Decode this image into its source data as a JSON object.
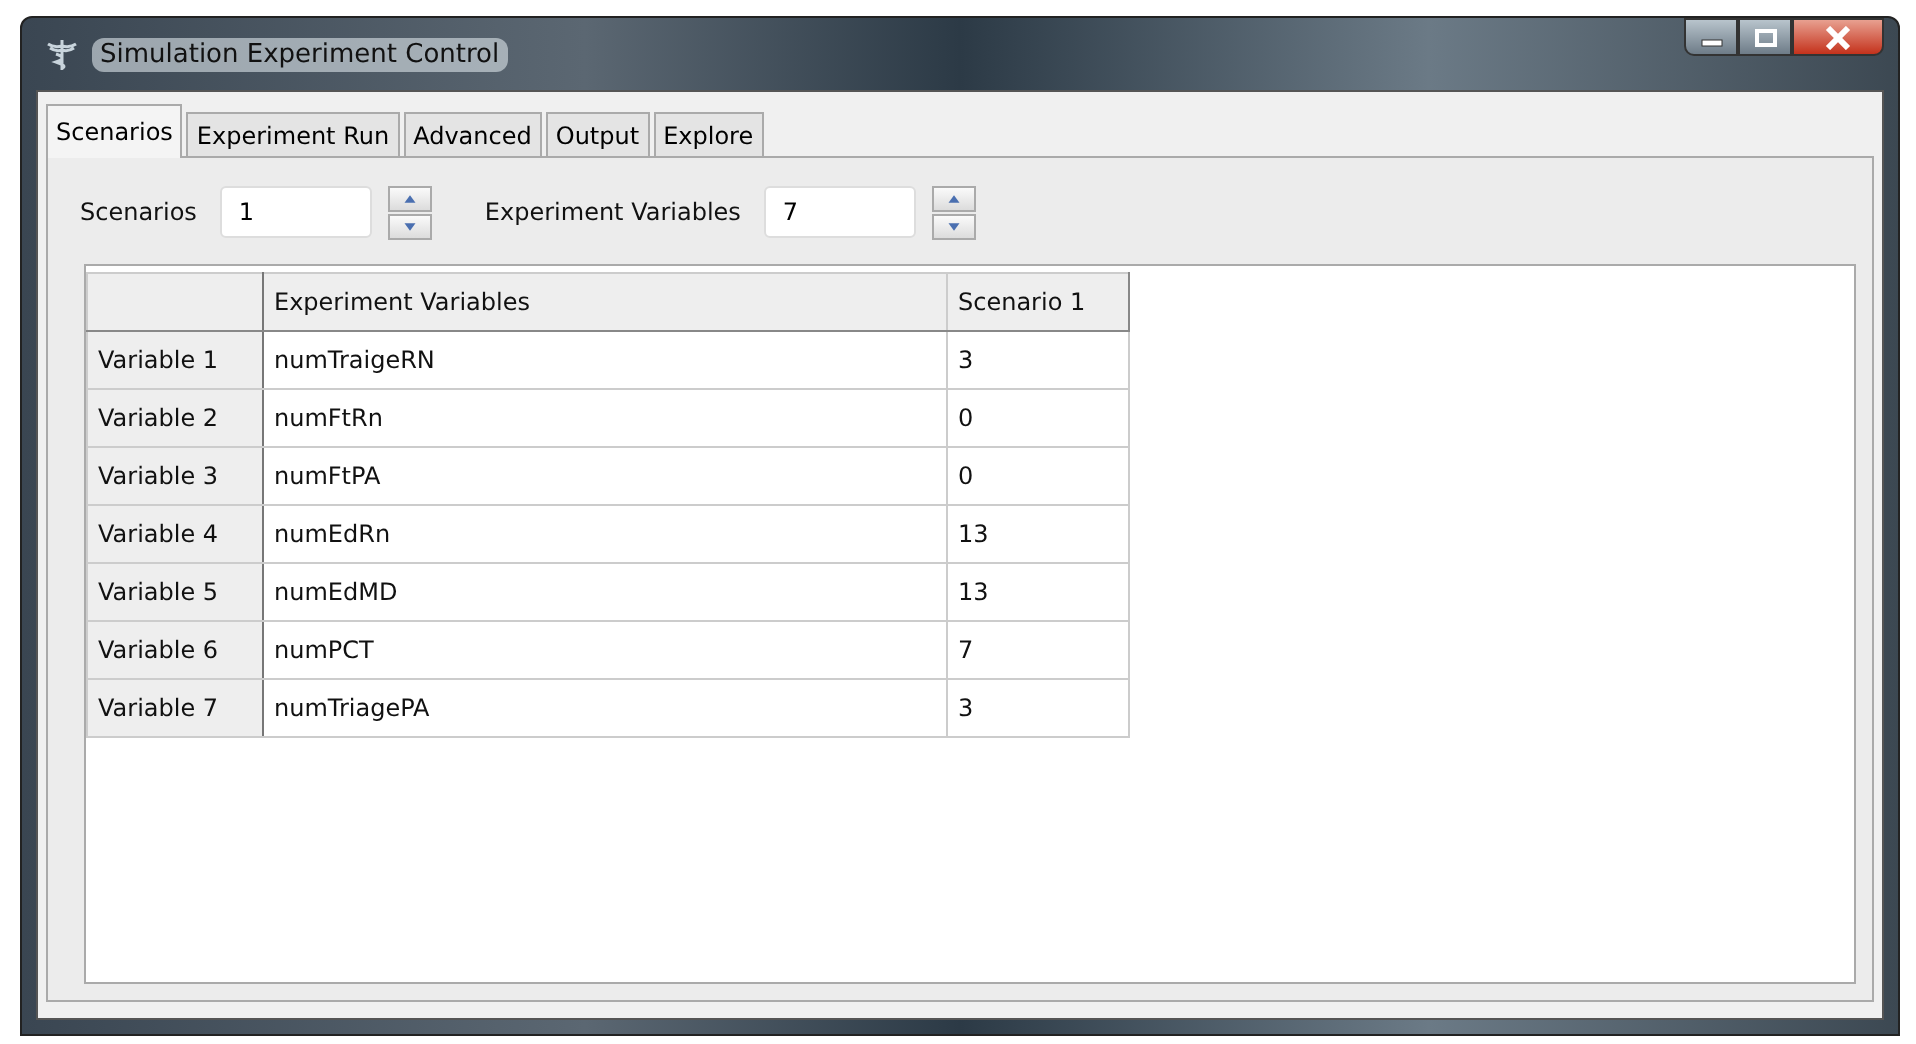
{
  "window": {
    "title": "Simulation Experiment Control"
  },
  "tabs": [
    {
      "label": "Scenarios",
      "selected": true
    },
    {
      "label": "Experiment Run",
      "selected": false
    },
    {
      "label": "Advanced",
      "selected": false
    },
    {
      "label": "Output",
      "selected": false
    },
    {
      "label": "Explore",
      "selected": false
    }
  ],
  "spinners": [
    {
      "label": "Scenarios",
      "value": "1"
    },
    {
      "label": "Experiment Variables",
      "value": "7"
    }
  ],
  "table": {
    "columns": [
      "Experiment Variables",
      "Scenario 1"
    ],
    "rows": [
      {
        "header": "Variable 1",
        "cells": [
          "numTraigeRN",
          "3"
        ]
      },
      {
        "header": "Variable 2",
        "cells": [
          "numFtRn",
          "0"
        ]
      },
      {
        "header": "Variable 3",
        "cells": [
          "numFtPA",
          "0"
        ]
      },
      {
        "header": "Variable 4",
        "cells": [
          "numEdRn",
          "13"
        ]
      },
      {
        "header": "Variable 5",
        "cells": [
          "numEdMD",
          "13"
        ]
      },
      {
        "header": "Variable 6",
        "cells": [
          "numPCT",
          "7"
        ]
      },
      {
        "header": "Variable 7",
        "cells": [
          "numTriagePA",
          "3"
        ]
      }
    ]
  }
}
